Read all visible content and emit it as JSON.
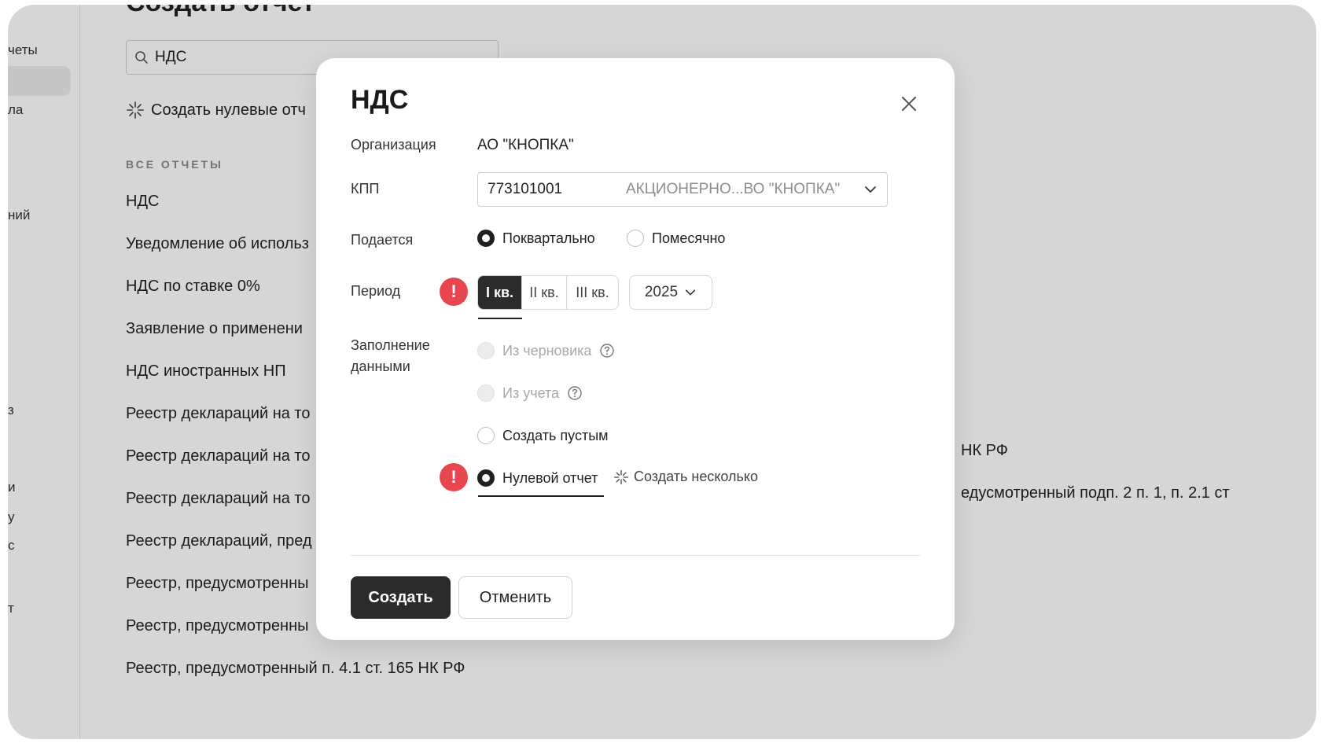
{
  "left_nav": {
    "fragments": [
      "четы",
      "ла",
      "ний",
      "з",
      "и",
      "у",
      "с",
      "т"
    ]
  },
  "page": {
    "title": "Создать отчет",
    "search": {
      "value": "НДС",
      "placeholder": ""
    },
    "zero_reports_label": "Создать нулевые отч",
    "section_label": "ВСЕ ОТЧЕТЫ",
    "reports": [
      "НДС",
      "Уведомление об использ",
      "НДС по ставке 0%",
      "Заявление о применени",
      "НДС иностранных НП",
      "Реестр деклараций на то",
      "Реестр деклараций на то",
      "Реестр деклараций на то",
      "Реестр деклараций, пред",
      "Реестр, предусмотренны",
      "Реестр, предусмотренны",
      "Реестр, предусмотренный п. 4.1 ст. 165 НК РФ"
    ],
    "overflow_texts": [
      "НК РФ",
      "едусмотренный подп. 2 п. 1, п. 2.1 ст"
    ]
  },
  "modal": {
    "title": "НДС",
    "organization_label": "Организация",
    "organization_value": "АО \"КНОПКА\"",
    "kpp_label": "КПП",
    "kpp_code": "773101001",
    "kpp_name": "АКЦИОНЕРНО...ВО \"КНОПКА\"",
    "submit_label": "Подается",
    "submit_options": [
      "Поквартально",
      "Помесячно"
    ],
    "period_label": "Период",
    "quarters": [
      "I кв.",
      "II кв.",
      "III кв."
    ],
    "year": "2025",
    "fill_label_1": "Заполнение",
    "fill_label_2": "данными",
    "fill_options": [
      "Из черновика",
      "Из учета",
      "Создать пустым",
      "Нулевой отчет"
    ],
    "create_several": "Создать несколько",
    "warning_mark": "!",
    "create_button": "Создать",
    "cancel_button": "Отменить"
  }
}
